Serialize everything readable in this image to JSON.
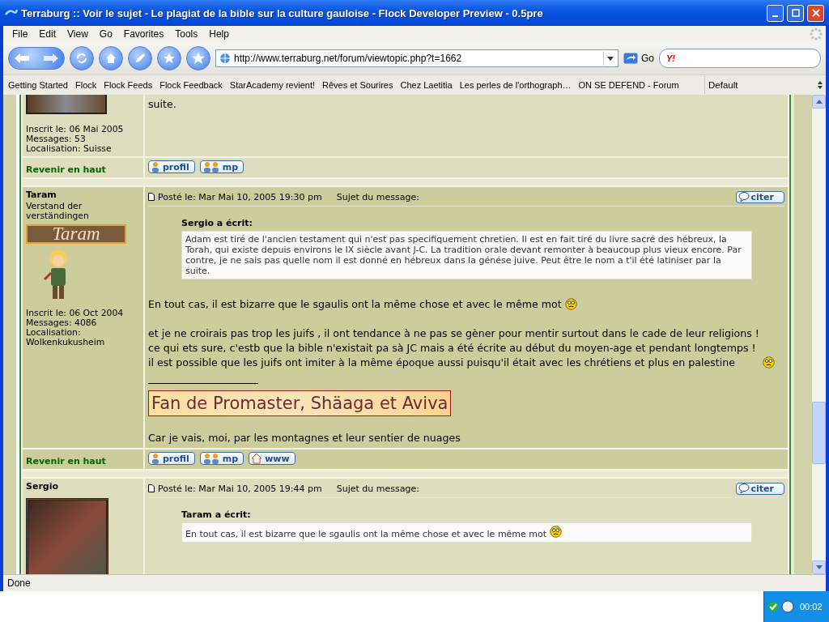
{
  "window": {
    "title": "Terraburg :: Voir le sujet - Le plagiat de la bible sur la culture gauloise - Flock Developer Preview - 0.5pre"
  },
  "menu": [
    "File",
    "Edit",
    "View",
    "Go",
    "Favorites",
    "Tools",
    "Help"
  ],
  "address": {
    "value": "http://www.terraburg.net/forum/viewtopic.php?t=1662",
    "go": "Go"
  },
  "search": {
    "engine": "Y!"
  },
  "bookmarks": [
    "Getting Started",
    "Flock",
    "Flock Feeds",
    "Flock Feedback",
    "StarAcademy revient!",
    "Rêves et Sourires",
    "Chez Laetitia",
    "Les perles de l'orthograph…",
    "ON SE DEFEND - Forum"
  ],
  "collection": "Default",
  "posts": [
    {
      "avatar": {
        "kind": "photo"
      },
      "info": [
        "Inscrit le: 06 Mai 2005",
        "Messages: 53",
        "Localisation: Suisse"
      ],
      "paragraphs": [
        {
          "lines": [
            "suite."
          ],
          "smiley": false
        }
      ],
      "footer": {
        "back": "Revenir en haut",
        "buttons": [
          {
            "kind": "profile",
            "label": "profil"
          },
          {
            "kind": "message",
            "label": "mp"
          }
        ]
      }
    },
    {
      "author": "Taram",
      "rank": "Verstand der verständingen",
      "rank_banner": "Taram",
      "avatar": {
        "kind": "figure"
      },
      "info": [
        "Inscrit le: 06 Oct 2004",
        "Messages: 4086",
        "Localisation: Wolkenkukusheim"
      ],
      "posted": "Posté le: Mar Mai 10, 2005 19:30 pm",
      "subject_label": "Sujet du message:",
      "quote_button": "citer",
      "quote": {
        "author": "Sergio a écrit:",
        "text": "Adam est tiré de l'ancien testament qui n'est pas specifiquement chretien. Il est en fait tiré du livre sacré des hébreux, la Torah, qui existe depuis environs le IX siècle avant J-C. La tradition orale devant remonter à beaucoup plus vieux encore. Par contre, je ne sais pas quelle nom il est donné en hébreux dans la génése juive. Peut être le nom a t'il été latiniser par la suite.",
        "smiley": false
      },
      "paragraphs": [
        {
          "lines": [
            "En tout cas, il est bizarre que le sgaulis ont la même chose et avec le même mot"
          ],
          "smiley": true
        },
        {
          "lines": [
            "et je ne croirais pas trop les juifs , il ont tendance à ne pas se gèner pour mentir surtout dans le cade de leur religions !",
            "ce qui ets sure, c'estb que la bible n'existait pa sà JC mais a été écrite au début du moyen-age et pendant longtemps !",
            "il est possible que les juifs ont imiter à la même époque aussi puisqu'il était avec les chrétiens et plus en palestine"
          ],
          "smiley": true
        }
      ],
      "signature": {
        "banner": "Fan de Promaster, Shäaga et Aviva",
        "text": "Car je vais, moi, par les montagnes et leur sentier de nuages"
      },
      "footer": {
        "back": "Revenir en haut",
        "buttons": [
          {
            "kind": "profile",
            "label": "profil"
          },
          {
            "kind": "message",
            "label": "mp"
          },
          {
            "kind": "website",
            "label": "www"
          }
        ]
      }
    },
    {
      "author": "Sergio",
      "avatar": {
        "kind": "photo"
      },
      "posted": "Posté le: Mar Mai 10, 2005 19:44 pm",
      "subject_label": "Sujet du message:",
      "quote_button": "citer",
      "quote": {
        "author": "Taram a écrit:",
        "text": "En tout cas, il est bizarre que le sgaulis ont la même chose et avec le même mot",
        "smiley": true
      }
    }
  ],
  "status_bar": "Done",
  "taskbar": {
    "clock": "00:02"
  }
}
